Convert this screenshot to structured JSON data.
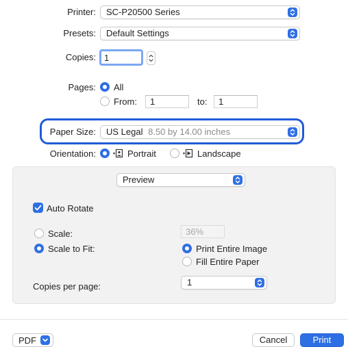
{
  "printer": {
    "label": "Printer:",
    "value": "SC-P20500 Series"
  },
  "presets": {
    "label": "Presets:",
    "value": "Default Settings"
  },
  "copies": {
    "label": "Copies:",
    "value": "1"
  },
  "pages": {
    "label": "Pages:",
    "all_label": "All",
    "from_label": "From:",
    "from_value": "1",
    "to_label": "to:",
    "to_value": "1"
  },
  "paper_size": {
    "label": "Paper Size:",
    "name": "US Legal",
    "dimensions": "8.50 by 14.00 inches"
  },
  "orientation": {
    "label": "Orientation:",
    "portrait_label": "Portrait",
    "landscape_label": "Landscape"
  },
  "section_popup": {
    "value": "Preview"
  },
  "preview": {
    "auto_rotate_label": "Auto Rotate",
    "scale_label": "Scale:",
    "scale_value": "36%",
    "scale_to_fit_label": "Scale to Fit:",
    "print_entire_image_label": "Print Entire Image",
    "fill_entire_paper_label": "Fill Entire Paper",
    "copies_per_page_label": "Copies per page:",
    "copies_per_page_value": "1"
  },
  "footer": {
    "pdf_label": "PDF",
    "cancel_label": "Cancel",
    "print_label": "Print"
  },
  "colors": {
    "accent": "#2f6fe4",
    "highlight_ring": "#1f5bd6",
    "panel_bg": "#f2f2f2"
  }
}
